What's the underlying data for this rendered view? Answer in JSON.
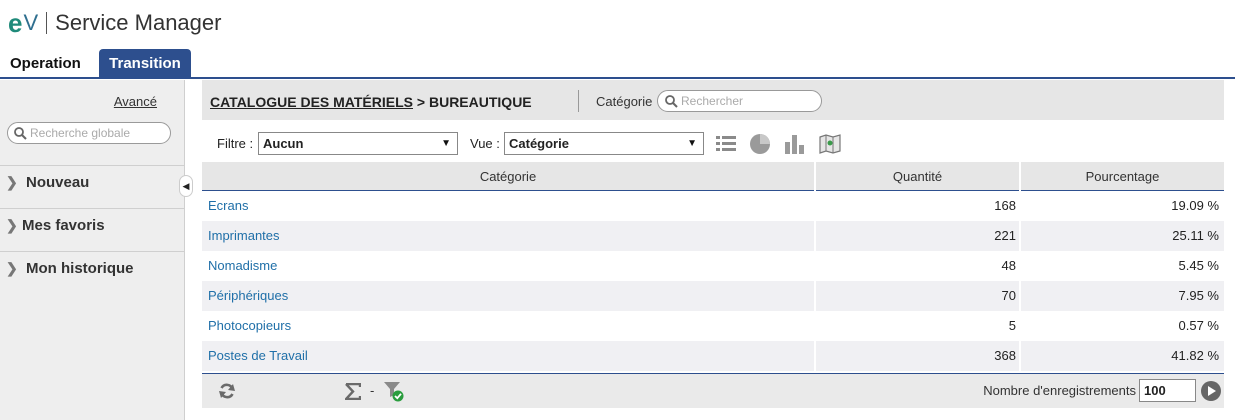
{
  "app": {
    "logo_e": "e",
    "logo_v": "V",
    "title": "Service Manager"
  },
  "tabs": [
    {
      "label": "Operation"
    },
    {
      "label": "Transition"
    }
  ],
  "sidebar": {
    "advanced": "Avancé",
    "global_search_placeholder": "Recherche globale",
    "items": [
      {
        "label": "Nouveau"
      },
      {
        "label": "Mes favoris"
      },
      {
        "label": "Mon historique"
      }
    ]
  },
  "main": {
    "breadcrumb_catalog": "CATALOGUE DES MATÉRIELS",
    "breadcrumb_sep": ">",
    "breadcrumb_current": "BUREAUTIQUE",
    "category_label": "Catégorie",
    "category_search_placeholder": "Rechercher",
    "filter_label": "Filtre :",
    "filter_value": "Aucun",
    "view_label": "Vue :",
    "view_value": "Catégorie",
    "view_icons": [
      "list-icon",
      "pie-chart-icon",
      "bar-chart-icon",
      "map-icon"
    ]
  },
  "table": {
    "columns": [
      "Catégorie",
      "Quantité",
      "Pourcentage"
    ],
    "rows": [
      {
        "category": "Ecrans",
        "quantity": "168",
        "percent": "19.09 %"
      },
      {
        "category": "Imprimantes",
        "quantity": "221",
        "percent": "25.11 %"
      },
      {
        "category": "Nomadisme",
        "quantity": "48",
        "percent": "5.45 %"
      },
      {
        "category": "Périphériques",
        "quantity": "70",
        "percent": "7.95 %"
      },
      {
        "category": "Photocopieurs",
        "quantity": "5",
        "percent": "0.57 %"
      },
      {
        "category": "Postes de Travail",
        "quantity": "368",
        "percent": "41.82 %"
      }
    ]
  },
  "footer": {
    "sigma_sep": "-",
    "records_label": "Nombre d'enregistrements",
    "records_value": "100"
  },
  "colors": {
    "accent": "#2d4f8e",
    "link": "#1f6fa8",
    "logo_green": "#1f8a7a"
  }
}
